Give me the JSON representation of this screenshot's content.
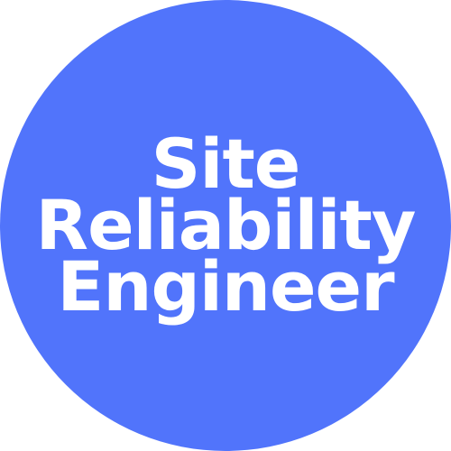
{
  "badge": {
    "lines": [
      "Site",
      "Reliability",
      "Engineer"
    ],
    "circle_color": "#5174fb",
    "text_color": "#ffffff",
    "background_color": "#ffffff"
  }
}
